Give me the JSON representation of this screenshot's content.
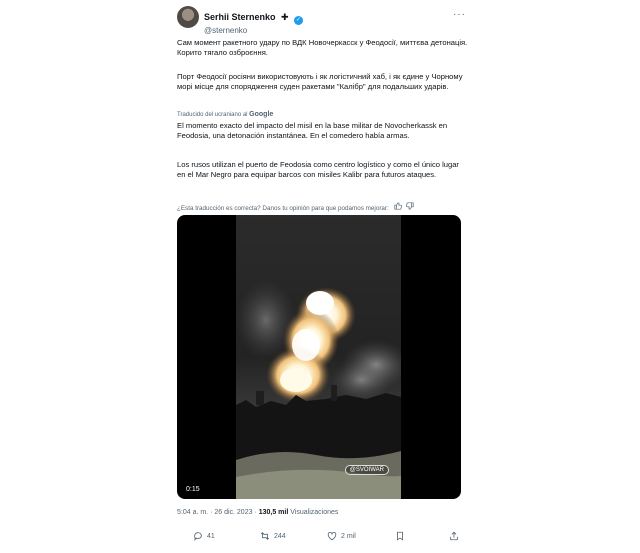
{
  "post": {
    "author_name": "Serhii Sternenko",
    "author_badge": "✚",
    "handle": "@sternenko",
    "more_icon": "more-horizontal-icon",
    "text_original_1": "Сам момент ракетного удару по ВДК Новочеркасск у Феодосії, миттєва детонація. Корито тягало озброєння.",
    "text_original_2": "Порт Феодосії росіяни використовують і як логістичний хаб, і як єдине у Чорному морі місце для спорядження суден ракетами \"Калібр\" для подальших ударів.",
    "translated_label": "Traducido del ucraniano al",
    "translated_provider": "Google",
    "text_translated_1": "El momento exacto del impacto del misil en la base militar de Novocherkassk en Feodosia, una detonación instantánea. En el comedero había armas.",
    "text_translated_2": "Los rusos utilizan el puerto de Feodosia como centro logístico y como el único lugar en el Mar Negro para equipar barcos con misiles Kalibr para futuros ataques.",
    "feedback_question": "¿Esta traducción es correcta? Danos tu opinión para que podamos mejorar:",
    "video": {
      "duration": "0:15",
      "watermark": "@SVOIWAR"
    },
    "timestamp": "5:04 a. m. · 26 dic. 2023 ·",
    "views_count": "130,5 mil",
    "views_label": "Visualizaciones",
    "actions": {
      "replies": "41",
      "reposts": "244",
      "likes": "2 mil",
      "bookmark_icon": "bookmark-icon"
    },
    "colors": {
      "verified": "#1d9bf0",
      "muted_text": "#536471",
      "main_text": "#0f1419"
    }
  }
}
